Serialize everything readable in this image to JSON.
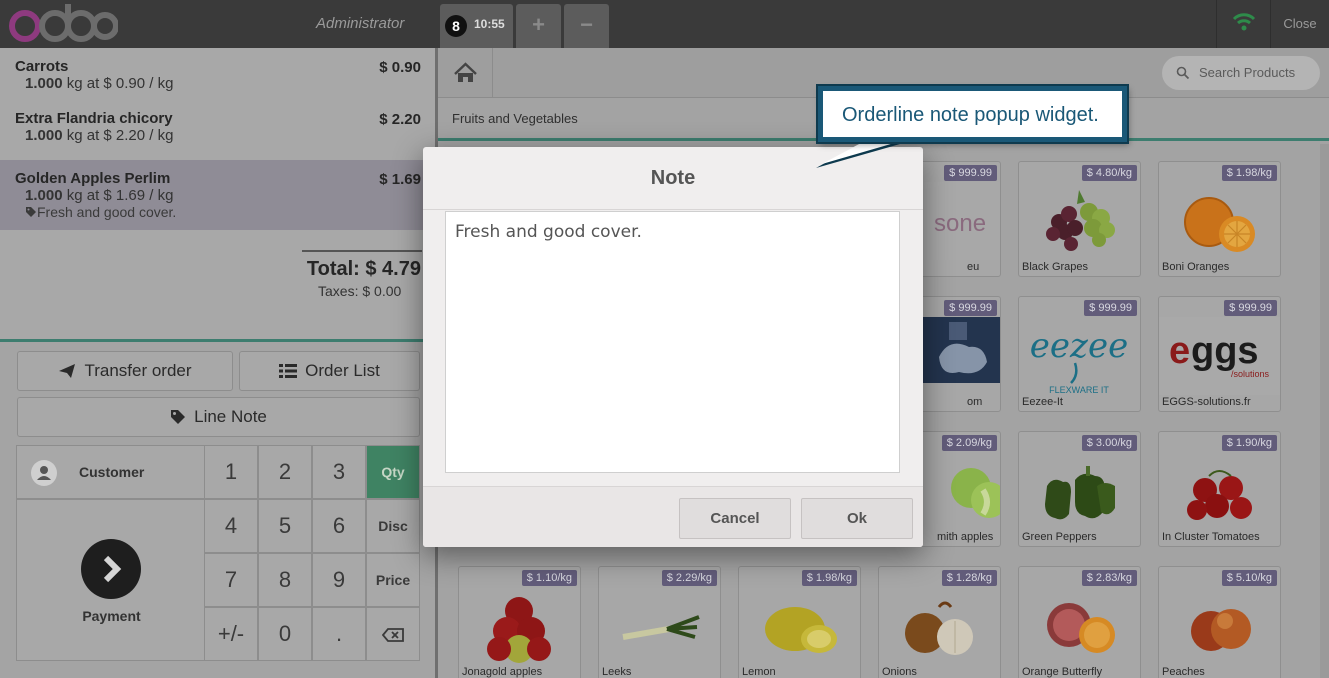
{
  "topbar": {
    "user": "Administrator",
    "order_badge": "8",
    "order_time": "10:55",
    "add_label": "+",
    "remove_label": "−",
    "close_label": "Close"
  },
  "orderlines": [
    {
      "name": "Carrots",
      "price": "$ 0.90",
      "qty": "1.000",
      "unit_text": "kg at $ 0.90 / kg"
    },
    {
      "name": "Extra Flandria chicory",
      "price": "$ 2.20",
      "qty": "1.000",
      "unit_text": "kg at $ 2.20 / kg"
    },
    {
      "name": "Golden Apples Perlim",
      "price": "$ 1.69",
      "qty": "1.000",
      "unit_text": "kg at $ 1.69 / kg",
      "note": "Fresh and good cover."
    }
  ],
  "summary": {
    "total": "Total: $ 4.79",
    "taxes": "Taxes: $ 0.00"
  },
  "controls": {
    "transfer": "Transfer order",
    "order_list": "Order List",
    "line_note": "Line Note"
  },
  "numpad": {
    "customer": "Customer",
    "payment": "Payment",
    "keys": [
      "1",
      "2",
      "3",
      "4",
      "5",
      "6",
      "7",
      "8",
      "9",
      "+/-",
      "0",
      "."
    ],
    "modes": [
      "Qty",
      "Disc",
      "Price"
    ]
  },
  "products_panel": {
    "search_placeholder": "Search Products",
    "breadcrumb": "Fruits and Vegetables",
    "cards": [
      {
        "name": "",
        "price": "$ 999.99"
      },
      {
        "name": "Black Grapes",
        "price": "$ 4.80/kg"
      },
      {
        "name": "Boni Oranges",
        "price": "$ 1.98/kg"
      },
      {
        "name": "",
        "price": "$ 999.99"
      },
      {
        "name": "Eezee-It",
        "price": "$ 999.99"
      },
      {
        "name": "EGGS-solutions.fr",
        "price": "$ 999.99"
      },
      {
        "name": "",
        "price": "$ 2.09/kg"
      },
      {
        "name": "Green Peppers",
        "price": "$ 3.00/kg"
      },
      {
        "name": "In Cluster Tomatoes",
        "price": "$ 1.90/kg"
      },
      {
        "name": "Jonagold apples",
        "price": "$ 1.10/kg"
      },
      {
        "name": "Leeks",
        "price": "$ 2.29/kg"
      },
      {
        "name": "Lemon",
        "price": "$ 1.98/kg"
      },
      {
        "name": "Onions",
        "price": "$ 1.28/kg"
      },
      {
        "name": "Orange Butterfly",
        "price": "$ 2.83/kg"
      },
      {
        "name": "Peaches",
        "price": "$ 5.10/kg"
      }
    ],
    "partial_labels": {
      "card0": "eu",
      "card0_logo": "sone",
      "card3": "om",
      "card6": "mith apples"
    }
  },
  "dialog": {
    "title": "Note",
    "text": "Fresh and good cover.",
    "cancel": "Cancel",
    "ok": "Ok"
  },
  "callout": {
    "text": "Orderline note popup widget."
  },
  "colors": {
    "accent_green": "#3d7d6f",
    "callout_blue": "#1a5877",
    "price_tag": "#625c7a"
  }
}
